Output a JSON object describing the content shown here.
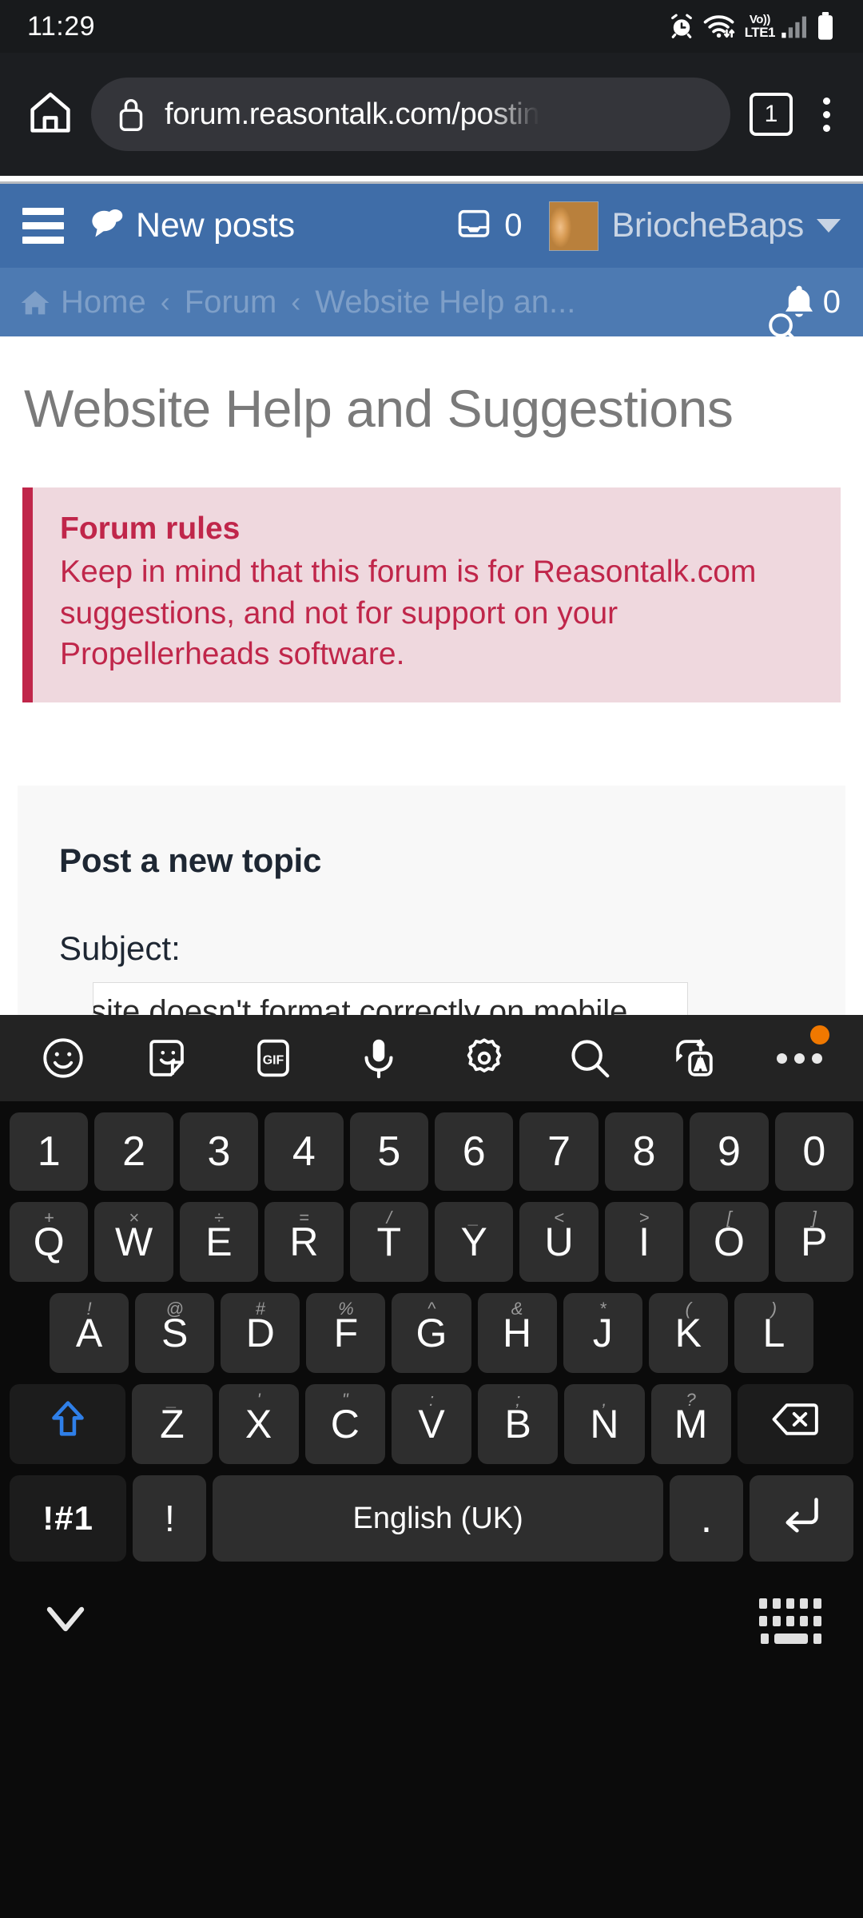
{
  "status_bar": {
    "time": "11:29",
    "icons": [
      "alarm-clock-icon",
      "wifi-icon",
      "volte-icon",
      "signal-bars-icon",
      "battery-icon"
    ],
    "network_label_top": "Vo))",
    "network_label_bottom": "LTE1"
  },
  "browser": {
    "home_icon": "home-icon",
    "lock_icon": "lock-icon",
    "url": "forum.reasontalk.com/postin",
    "tab_count": "1",
    "menu_icon": "kebab-menu-icon"
  },
  "forum_nav": {
    "menu_icon": "hamburger-menu-icon",
    "new_posts_label": "New posts",
    "new_posts_icon": "comments-icon",
    "inbox_icon": "inbox-icon",
    "inbox_count": "0",
    "username": "BriocheBaps",
    "avatar": "user-avatar",
    "dropdown_icon": "chevron-down-icon",
    "accent_color": "#3f6da8"
  },
  "breadcrumb": {
    "home_icon": "home-solid-icon",
    "items": [
      "Home",
      "Forum",
      "Website Help an..."
    ],
    "separator": "‹",
    "bell_icon": "bell-icon",
    "bell_count": "0",
    "search_icon": "search-icon",
    "bar_color": "#4d7ab2"
  },
  "page": {
    "title": "Website Help and Suggestions",
    "rules": {
      "heading": "Forum rules",
      "body": "Keep in mind that this forum is for Reasontalk.com suggestions, and not for support on your Propellerheads software.",
      "accent_color": "#c0264a",
      "background_color": "#efd8de"
    },
    "post_form": {
      "heading": "Post a new topic",
      "subject_label": "Subject:",
      "subject_value": "site doesn't format correctly on mobile",
      "subject_placeholder": ""
    }
  },
  "keyboard": {
    "toolbar": [
      {
        "name": "emoji-icon"
      },
      {
        "name": "sticker-icon"
      },
      {
        "name": "gif-icon",
        "label": "GIF"
      },
      {
        "name": "microphone-icon"
      },
      {
        "name": "settings-gear-icon"
      },
      {
        "name": "search-icon"
      },
      {
        "name": "translate-icon"
      },
      {
        "name": "overflow-menu-icon",
        "badge": true
      }
    ],
    "badge_color": "#f07800",
    "rows": {
      "numbers": [
        {
          "main": "1"
        },
        {
          "main": "2"
        },
        {
          "main": "3"
        },
        {
          "main": "4"
        },
        {
          "main": "5"
        },
        {
          "main": "6"
        },
        {
          "main": "7"
        },
        {
          "main": "8"
        },
        {
          "main": "9"
        },
        {
          "main": "0"
        }
      ],
      "top": [
        {
          "main": "Q",
          "sub": "+"
        },
        {
          "main": "W",
          "sub": "×"
        },
        {
          "main": "E",
          "sub": "÷"
        },
        {
          "main": "R",
          "sub": "="
        },
        {
          "main": "T",
          "sub": "/"
        },
        {
          "main": "Y",
          "sub": "_"
        },
        {
          "main": "U",
          "sub": "<"
        },
        {
          "main": "I",
          "sub": ">"
        },
        {
          "main": "O",
          "sub": "["
        },
        {
          "main": "P",
          "sub": "]"
        }
      ],
      "home": [
        {
          "main": "A",
          "sub": "!"
        },
        {
          "main": "S",
          "sub": "@"
        },
        {
          "main": "D",
          "sub": "#"
        },
        {
          "main": "F",
          "sub": "%"
        },
        {
          "main": "G",
          "sub": "^"
        },
        {
          "main": "H",
          "sub": "&"
        },
        {
          "main": "J",
          "sub": "*"
        },
        {
          "main": "K",
          "sub": "("
        },
        {
          "main": "L",
          "sub": ")"
        }
      ],
      "bottom_letters": [
        {
          "main": "Z",
          "sub": "_"
        },
        {
          "main": "X",
          "sub": "'"
        },
        {
          "main": "C",
          "sub": "\""
        },
        {
          "main": "V",
          "sub": ":"
        },
        {
          "main": "B",
          "sub": ";"
        },
        {
          "main": "N",
          "sub": ","
        },
        {
          "main": "M",
          "sub": "?"
        }
      ],
      "shift_icon": "shift-arrow-icon",
      "shift_color": "#2f7fe8",
      "backspace_icon": "backspace-icon",
      "function_row": {
        "symbols_label": "!#1",
        "exclaim_label": "!",
        "space_label": "English (UK)",
        "period_label": ".",
        "enter_icon": "enter-return-icon"
      }
    },
    "nav": {
      "dismiss_icon": "chevron-down-icon",
      "switch_keyboard_icon": "keyboard-switch-icon"
    }
  }
}
